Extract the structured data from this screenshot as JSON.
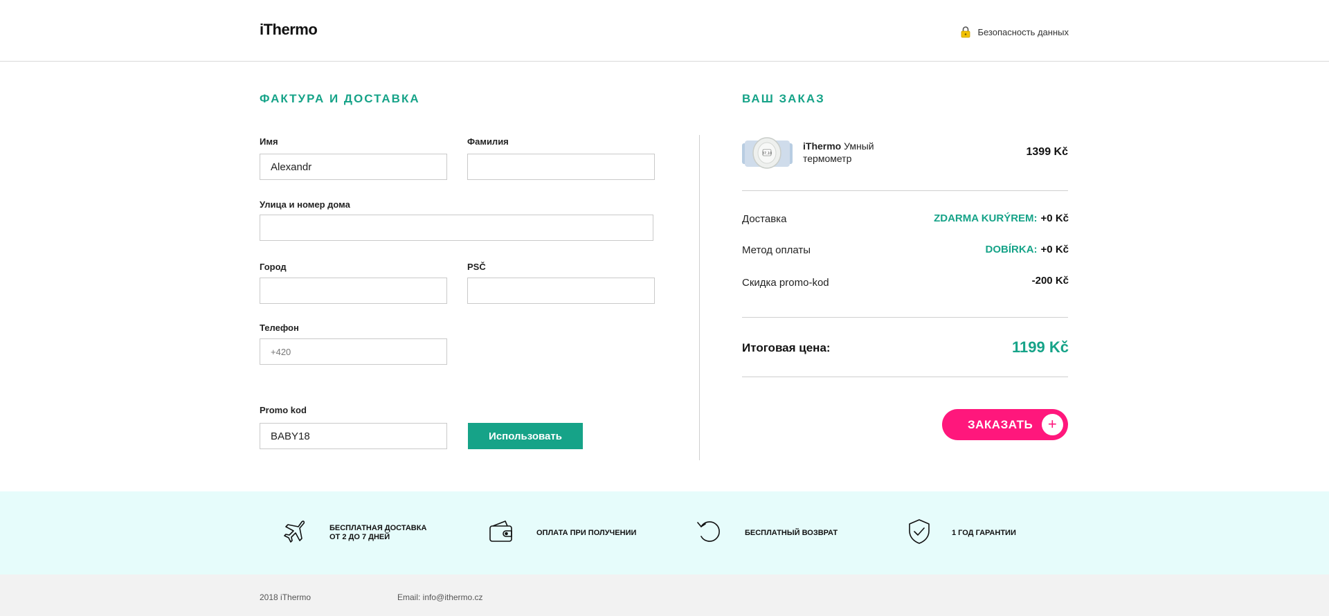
{
  "header": {
    "logo": "iThermo",
    "secure_label": "Безопасность данных"
  },
  "billing": {
    "title": "ФАКТУРА И ДОСТАВКА",
    "first_name": {
      "label": "Имя",
      "value": "Alexandr"
    },
    "last_name": {
      "label": "Фамилия",
      "value": ""
    },
    "street": {
      "label": "Улица и номер дома",
      "value": ""
    },
    "city": {
      "label": "Город",
      "value": ""
    },
    "zip": {
      "label": "PSČ",
      "value": ""
    },
    "phone": {
      "label": "Телефон",
      "placeholder": "+420"
    },
    "promo": {
      "label": "Promo kod",
      "value": "BABY18",
      "apply_label": "Использовать"
    }
  },
  "order": {
    "title": "ВАШ ЗАКАЗ",
    "product": {
      "brand": "iThermo",
      "name": "Умный термометр",
      "price": "1399 Kč",
      "image_text": "37,10"
    },
    "delivery": {
      "label": "Доставка",
      "method": "ZDARMA KURÝREM:",
      "price": "+0 Kč"
    },
    "payment": {
      "label": "Метод оплаты",
      "method": "DOBÍRKA:",
      "price": "+0 Kč"
    },
    "discount": {
      "label": "Скидка promo-kod",
      "price": "-200 Kč"
    },
    "total": {
      "label": "Итоговая цена:",
      "price": "1199 Kč"
    },
    "submit_label": "ЗАКАЗАТЬ",
    "submit_icon": "+"
  },
  "benefits": [
    {
      "icon": "plane-icon",
      "text_line1": "БЕСПЛАТНАЯ ДОСТАВКА",
      "text_line2": "ОТ 2 ДО 7 ДНЕЙ"
    },
    {
      "icon": "wallet-icon",
      "text_line1": "ОПЛАТА ПРИ ПОЛУЧЕНИИ",
      "text_line2": ""
    },
    {
      "icon": "return-icon",
      "text_line1": "БЕСПЛАТНЫЙ ВОЗВРАТ",
      "text_line2": ""
    },
    {
      "icon": "shield-check-icon",
      "text_line1": "1 ГОД ГАРАНТИИ",
      "text_line2": ""
    }
  ],
  "footer": {
    "copyright": "2018 iThermo",
    "email": "Email: info@ithermo.cz"
  },
  "colors": {
    "accent": "#16a388",
    "cta": "#ff177c",
    "benefits_bg": "#e6fcfb",
    "footer_bg": "#f2f2f2"
  }
}
